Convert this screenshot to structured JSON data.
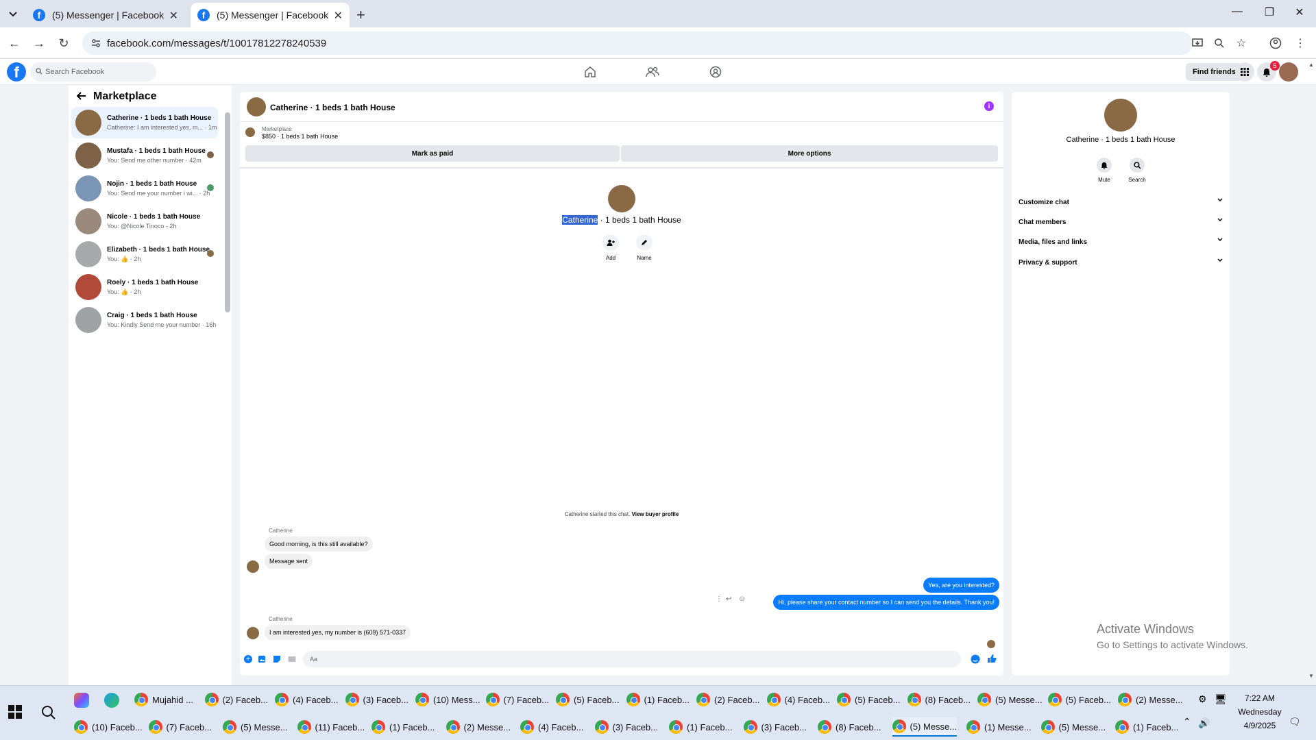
{
  "browser": {
    "tabs": [
      {
        "title": "(5) Messenger | Facebook"
      },
      {
        "title": "(5) Messenger | Facebook"
      }
    ],
    "url": "facebook.com/messages/t/10017812278240539"
  },
  "fb_header": {
    "search_placeholder": "Search Facebook",
    "find_friends": "Find friends",
    "notification_count": "5"
  },
  "chat_list": {
    "title": "Marketplace",
    "items": [
      {
        "name": "Catherine · 1 beds 1 bath House",
        "preview": "Catherine: I am interested yes, m... · 1m",
        "color": "#8a6a45"
      },
      {
        "name": "Mustafa · 1 beds 1 bath House",
        "preview": "You: Send me other number · 42m",
        "color": "#7d6248"
      },
      {
        "name": "Nojin · 1 beds 1 bath House",
        "preview": "You: Send me your number i wi... · 2h",
        "color": "#7a95b5"
      },
      {
        "name": "Nicole · 1 beds 1 bath House",
        "preview": "You: @Nicole Tinoco · 2h",
        "color": "#9b8a7c"
      },
      {
        "name": "Elizabeth · 1 beds 1 bath House",
        "preview": "You: 👍 · 2h",
        "color": "#a7a9ab"
      },
      {
        "name": "Roely · 1 beds 1 bath House",
        "preview": "You: 👍 · 2h",
        "color": "#b24a3a"
      },
      {
        "name": "Craig · 1 beds 1 bath House",
        "preview": "You: Kindly Send me your number · 16h",
        "color": "#9fa3a6"
      }
    ]
  },
  "conversation": {
    "title": "Catherine · 1 beds 1 bath House",
    "marketplace_label": "Marketplace",
    "listing": "$850 · 1 beds 1 bath House",
    "mark_paid": "Mark as paid",
    "more_options": "More options",
    "profile_name_highlight": "Catherine",
    "profile_name_rest": " · 1 beds 1 bath House",
    "add_label": "Add",
    "name_label": "Name",
    "started_text": "Catherine started this chat.",
    "view_buyer": "View buyer profile",
    "messages": {
      "sender1": "Catherine",
      "in1": "Good morning, is this still available?",
      "in2": "Message sent",
      "out1": "Yes, are you interested?",
      "out2": "Hi, please share your contact number so I can send you the details. Thank you!",
      "sender2": "Catherine",
      "in3": "I am interested yes, my number is (609) 571-0337"
    },
    "composer_placeholder": "Aa"
  },
  "right_panel": {
    "name": "Catherine · 1 beds 1 bath House",
    "mute": "Mute",
    "search": "Search",
    "rows": [
      "Customize chat",
      "Chat members",
      "Media, files and links",
      "Privacy & support"
    ]
  },
  "watermark": {
    "line1": "Activate Windows",
    "line2": "Go to Settings to activate Windows."
  },
  "taskbar": {
    "row1": [
      "Mujahid ...",
      "(2) Faceb...",
      "(4) Faceb...",
      "(3) Faceb...",
      "(10) Mess...",
      "(7) Faceb...",
      "(5) Faceb...",
      "(1) Faceb...",
      "(2) Faceb...",
      "(4) Faceb...",
      "(5) Faceb...",
      "(8) Faceb...",
      "(5) Messe...",
      "(5) Faceb...",
      "(2) Messe..."
    ],
    "row2": [
      "(10) Faceb...",
      "(7) Faceb...",
      "(5) Messe...",
      "(11) Faceb...",
      "(1) Faceb...",
      "(2) Messe...",
      "(4) Faceb...",
      "(3) Faceb...",
      "(1) Faceb...",
      "(3) Faceb...",
      "(8) Faceb...",
      "(5) Messe...",
      "(1) Messe...",
      "(5) Messe...",
      "(1) Faceb..."
    ],
    "time": "7:22 AM",
    "day": "Wednesday",
    "date": "4/9/2025"
  }
}
